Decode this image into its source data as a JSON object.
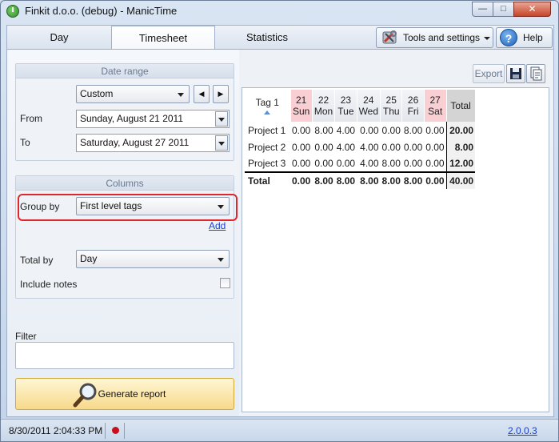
{
  "window": {
    "title": "Finkit d.o.o. (debug) - ManicTime",
    "minimize": "—",
    "maximize": "□",
    "close": "✕"
  },
  "tabs": [
    {
      "label": "Day"
    },
    {
      "label": "Timesheet",
      "selected": true
    },
    {
      "label": "Statistics"
    }
  ],
  "toolbar": {
    "tools_label": "Tools and settings",
    "help_label": "Help"
  },
  "date_range": {
    "header": "Date range",
    "preset": "Custom",
    "prev": "◀",
    "next": "▶",
    "from_label": "From",
    "from_value": "Sunday, August 21 2011",
    "to_label": "To",
    "to_value": "Saturday, August 27 2011"
  },
  "columns": {
    "header": "Columns",
    "group_by_label": "Group by",
    "group_by_value": "First level tags",
    "add_link": "Add",
    "total_by_label": "Total by",
    "total_by_value": "Day",
    "include_notes_label": "Include notes",
    "include_notes_checked": false
  },
  "filter": {
    "label": "Filter",
    "value": ""
  },
  "generate_button": "Generate report",
  "export": {
    "label": "Export",
    "icons": [
      "save-icon",
      "copy-icon"
    ]
  },
  "report": {
    "tag_header": "Tag 1",
    "days": [
      {
        "num": "21",
        "name": "Sun",
        "weekend": true
      },
      {
        "num": "22",
        "name": "Mon",
        "weekend": false
      },
      {
        "num": "23",
        "name": "Tue",
        "weekend": false
      },
      {
        "num": "24",
        "name": "Wed",
        "weekend": false
      },
      {
        "num": "25",
        "name": "Thu",
        "weekend": false
      },
      {
        "num": "26",
        "name": "Fri",
        "weekend": false
      },
      {
        "num": "27",
        "name": "Sat",
        "weekend": true
      }
    ],
    "total_header": "Total",
    "rows": [
      {
        "name": "Project 1",
        "values": [
          "0.00",
          "8.00",
          "4.00",
          "0.00",
          "0.00",
          "8.00",
          "0.00"
        ],
        "total": "20.00"
      },
      {
        "name": "Project 2",
        "values": [
          "0.00",
          "0.00",
          "4.00",
          "4.00",
          "0.00",
          "0.00",
          "0.00"
        ],
        "total": "8.00"
      },
      {
        "name": "Project 3",
        "values": [
          "0.00",
          "0.00",
          "0.00",
          "4.00",
          "8.00",
          "0.00",
          "0.00"
        ],
        "total": "12.00"
      }
    ],
    "totals": {
      "name": "Total",
      "values": [
        "0.00",
        "8.00",
        "8.00",
        "8.00",
        "8.00",
        "8.00",
        "0.00"
      ],
      "total": "40.00"
    }
  },
  "status": {
    "datetime": "8/30/2011 2:04:33 PM",
    "version": "2.0.0.3"
  },
  "colors": {
    "highlight": "#e0262a",
    "weekend": "#f9cfd3",
    "link": "#1a3fd0",
    "record": "#c8101b"
  }
}
